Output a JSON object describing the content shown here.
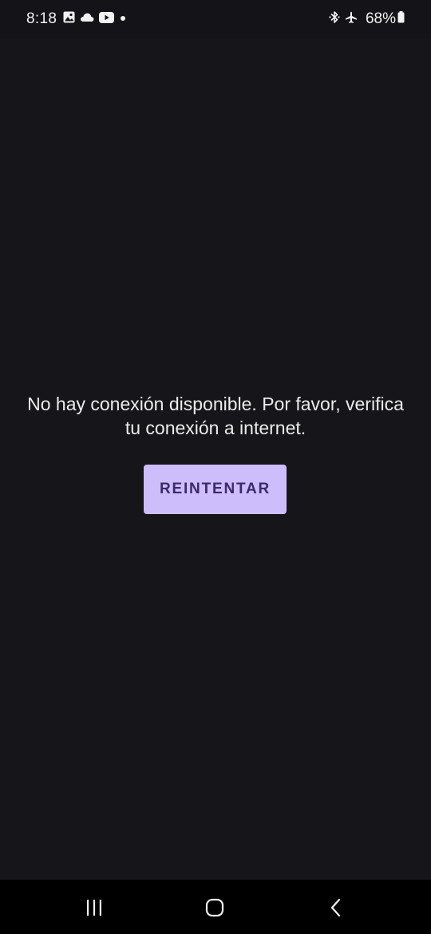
{
  "status_bar": {
    "time": "8:18",
    "left_icons": [
      "gallery-icon",
      "cloud-icon",
      "youtube-icon",
      "notification-dot-icon"
    ],
    "right_icons": [
      "bluetooth-icon",
      "airplane-mode-icon",
      "battery-icon"
    ],
    "battery_percent": "68%"
  },
  "main": {
    "message": "No hay conexión disponible. Por favor, verifica tu conexión a internet.",
    "retry_label": "REINTENTAR",
    "retry_color": "#cdbdfb",
    "background_color": "#16161a"
  },
  "nav_bar": {
    "buttons": [
      "recent-apps-icon",
      "home-icon",
      "back-icon"
    ]
  }
}
